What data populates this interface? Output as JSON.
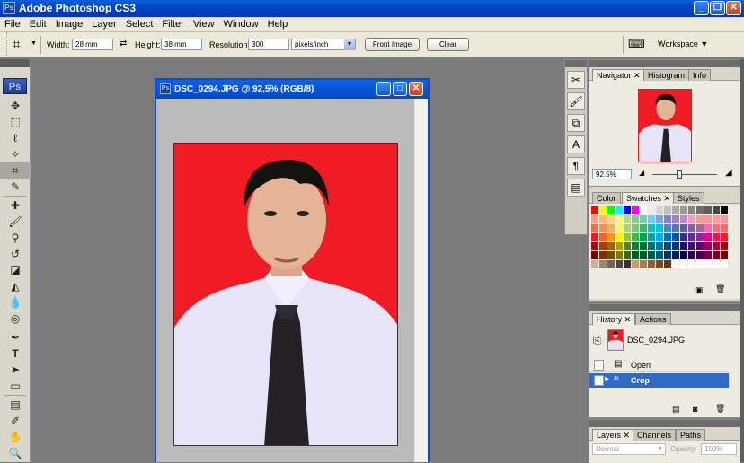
{
  "app": {
    "title": "Adobe Photoshop CS3",
    "logo": "Ps"
  },
  "menu": [
    "File",
    "Edit",
    "Image",
    "Layer",
    "Select",
    "Filter",
    "View",
    "Window",
    "Help"
  ],
  "options": {
    "width_label": "Width:",
    "width_value": "28 mm",
    "height_label": "Height:",
    "height_value": "38 mm",
    "resolution_label": "Resolution:",
    "resolution_value": "300",
    "resolution_unit": "pixels/inch",
    "front_image": "Front Image",
    "clear": "Clear",
    "workspace": "Workspace"
  },
  "document": {
    "title": "DSC_0294.JPG @ 92,5% (RGB/8)"
  },
  "navigator": {
    "tabs": [
      "Navigator",
      "Histogram",
      "Info"
    ],
    "zoom": "92.5%"
  },
  "swatches": {
    "tabs": [
      "Color",
      "Swatches",
      "Styles"
    ]
  },
  "history": {
    "tabs": [
      "History",
      "Actions"
    ],
    "snapshot": "DSC_0294.JPG",
    "items": [
      "Open",
      "Crop"
    ]
  },
  "layers": {
    "tabs": [
      "Layers",
      "Channels",
      "Paths"
    ],
    "blend_mode": "Normal",
    "opacity_label": "Opacity:",
    "opacity_value": "100%"
  },
  "colors": {
    "title_bar": "#0446c4",
    "selection": "#316ac5",
    "photo_bg": "#ef1c25"
  }
}
